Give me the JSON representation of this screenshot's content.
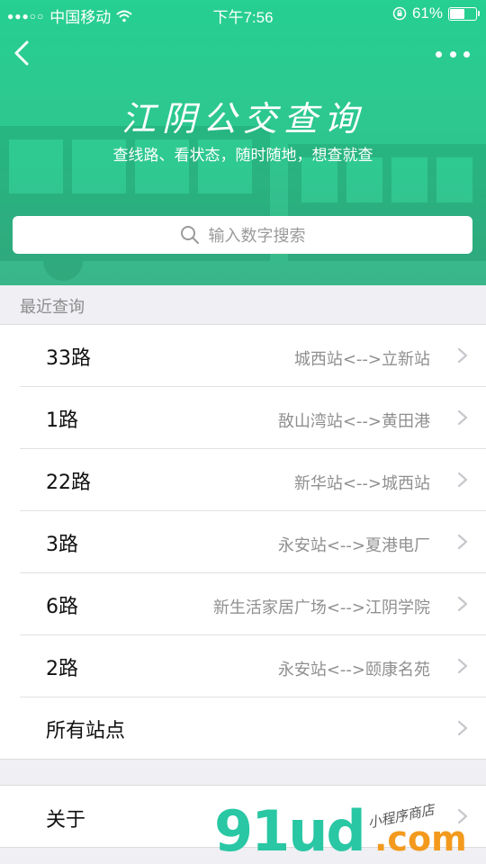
{
  "status_bar": {
    "signal": "●●●○○",
    "carrier": "中国移动",
    "time": "下午7:56",
    "battery_text": "61%",
    "battery_level": 0.61
  },
  "header": {
    "title": "江阴公交查询",
    "subtitle": "查线路、看状态，随时随地，想查就查",
    "back_icon": "chevron-left-icon",
    "more_icon": "more-dots-icon"
  },
  "search": {
    "placeholder": "输入数字搜索",
    "icon": "search-icon"
  },
  "recent": {
    "label": "最近查询",
    "items": [
      {
        "name": "33路",
        "route": "城西站<-->立新站"
      },
      {
        "name": "1路",
        "route": "敔山湾站<-->黄田港"
      },
      {
        "name": "22路",
        "route": "新华站<-->城西站"
      },
      {
        "name": "3路",
        "route": "永安站<-->夏港电厂"
      },
      {
        "name": "6路",
        "route": "新生活家居广场<-->江阴学院"
      },
      {
        "name": "2路",
        "route": "永安站<-->颐康名苑"
      },
      {
        "name": "所有站点",
        "route": ""
      }
    ]
  },
  "about": {
    "label": "关于"
  },
  "watermark": {
    "big": "91ud",
    "small": "小程序商店",
    "suffix": ".com"
  },
  "colors": {
    "accent": "#2bc890",
    "watermark_green": "#29c7a4",
    "watermark_orange": "#f39a1e"
  }
}
